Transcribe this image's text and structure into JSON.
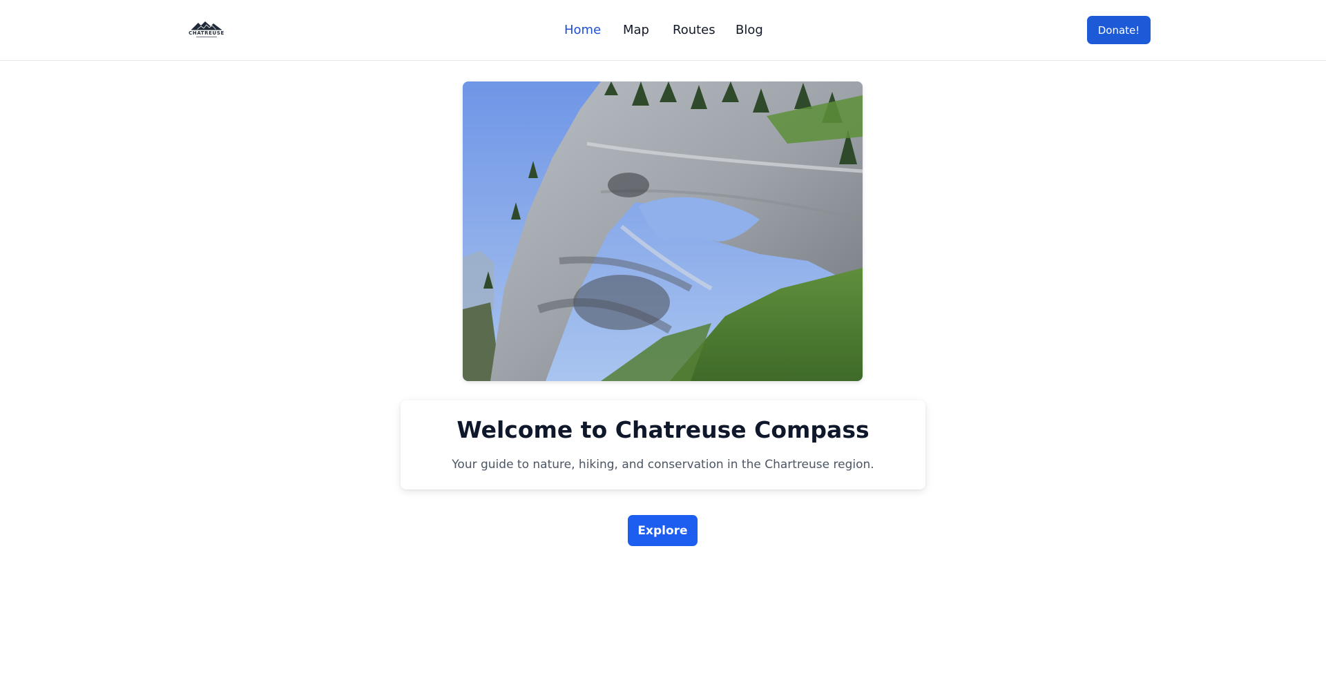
{
  "header": {
    "logo_text": "CHATREUSE",
    "nav": [
      {
        "label": "Home",
        "active": true
      },
      {
        "label": "Map",
        "active": false
      },
      {
        "label": "Routes",
        "active": false
      },
      {
        "label": "Blog",
        "active": false
      }
    ],
    "donate_label": "Donate!"
  },
  "hero": {
    "image_icon": "mountain-rock-arch-photo"
  },
  "card": {
    "title": "Welcome to Chatreuse Compass",
    "subtitle": "Your guide to nature, hiking, and conservation in the Chartreuse region."
  },
  "cta": {
    "explore_label": "Explore"
  },
  "colors": {
    "accent": "#1d5ad8",
    "nav_active": "#1d4ed8",
    "text_primary": "#0f172a",
    "text_secondary": "#4b5563"
  }
}
